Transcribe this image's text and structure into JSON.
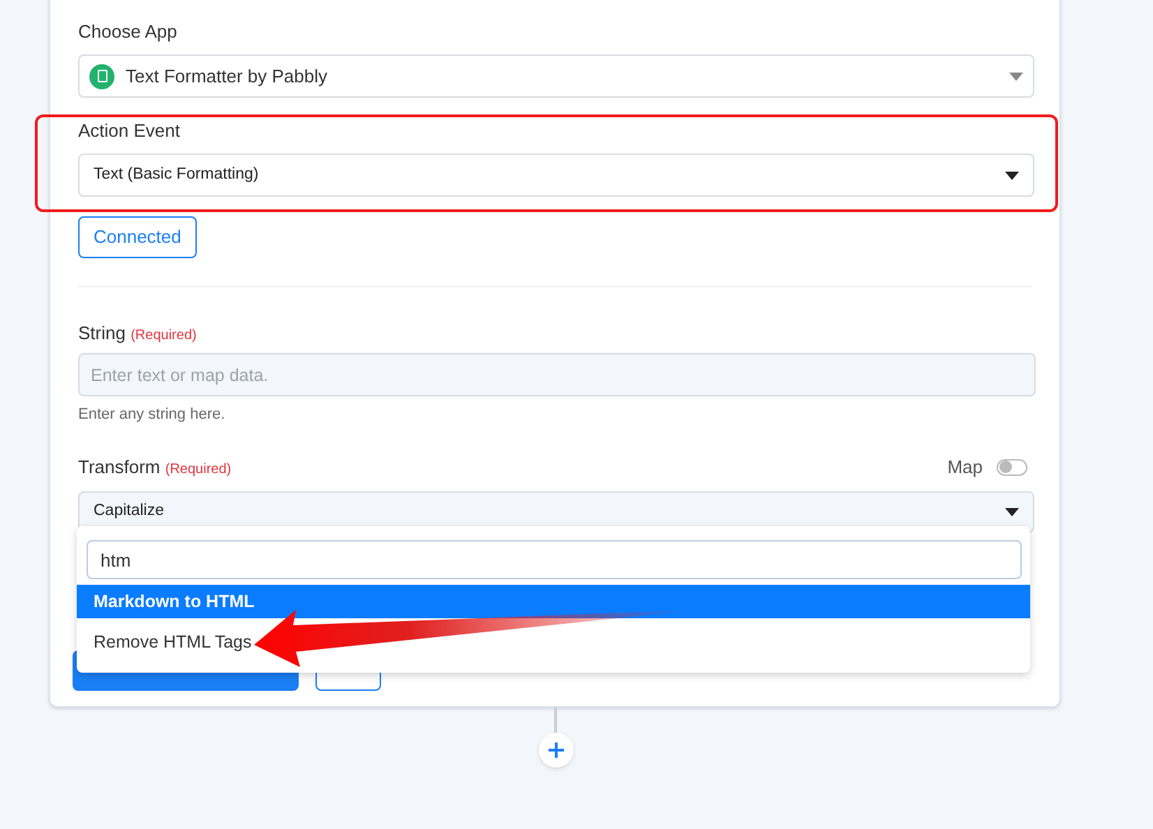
{
  "choose_app": {
    "label": "Choose App",
    "value": "Text Formatter by Pabbly"
  },
  "action_event": {
    "label": "Action Event",
    "value": "Text (Basic Formatting)",
    "highlighted": true
  },
  "connected_button": "Connected",
  "string_field": {
    "label": "String",
    "required": "(Required)",
    "placeholder": "Enter text or map data.",
    "help": "Enter any string here."
  },
  "transform_field": {
    "label": "Transform",
    "required": "(Required)",
    "map_label": "Map",
    "map_on": false,
    "value": "Capitalize"
  },
  "dropdown": {
    "search_value": "htm",
    "options": [
      {
        "label": "Markdown to HTML",
        "selected": true
      },
      {
        "label": "Remove HTML Tags",
        "selected": false
      }
    ]
  }
}
